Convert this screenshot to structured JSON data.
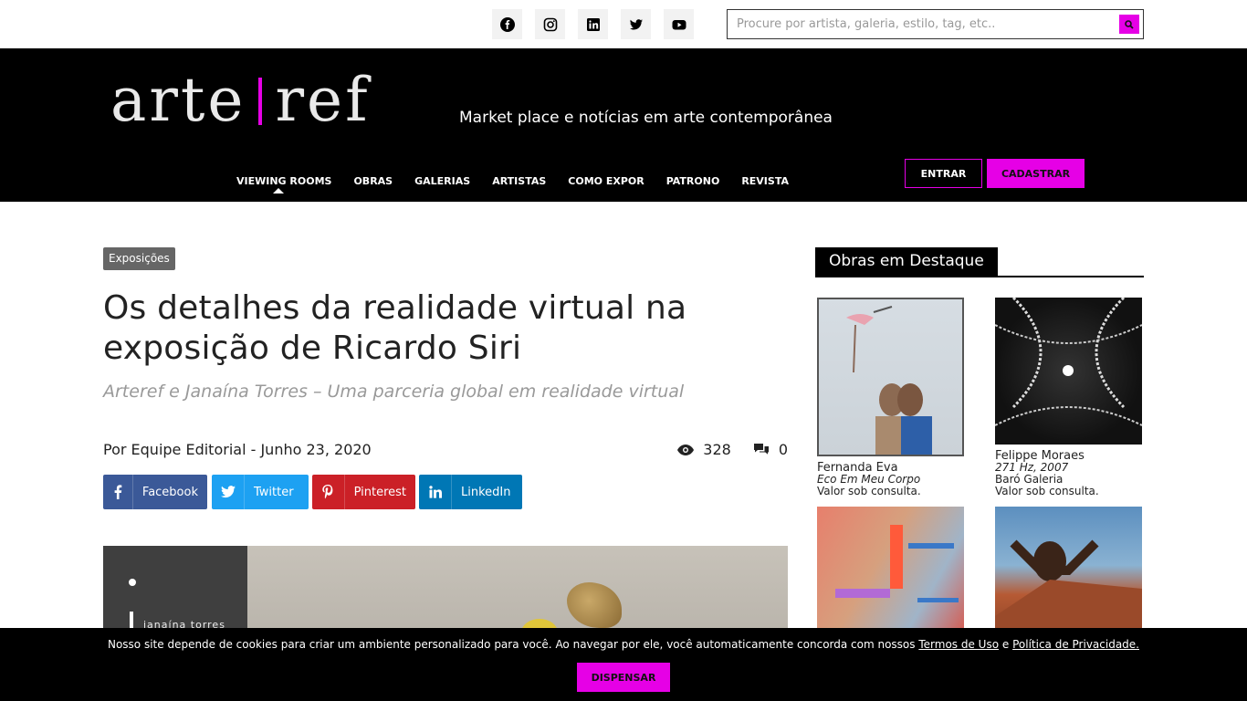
{
  "topbar": {
    "social_icons": [
      "facebook-icon",
      "instagram-icon",
      "linkedin-icon",
      "twitter-icon",
      "youtube-icon"
    ],
    "search_placeholder": "Procure por artista, galeria, estilo, tag, etc.."
  },
  "header": {
    "logo_left": "arte",
    "logo_right": "ref",
    "tagline": "Market place e notícias em arte contemporânea",
    "nav": [
      "VIEWING ROOMS",
      "OBRAS",
      "GALERIAS",
      "ARTISTAS",
      "COMO EXPOR",
      "PATRONO",
      "REVISTA"
    ],
    "entrar": "ENTRAR",
    "cadastrar": "CADASTRAR"
  },
  "article": {
    "category": "Exposições",
    "title": "Os detalhes da realidade virtual na exposição de Ricardo Siri",
    "subtitle": "Arteref e Janaína Torres – Uma parceria global em realidade virtual",
    "byline": "Por Equipe Editorial - Junho 23, 2020",
    "views": "328",
    "comments": "0",
    "share": {
      "facebook": "Facebook",
      "twitter": "Twitter",
      "pinterest": "Pinterest",
      "linkedin": "LinkedIn"
    },
    "hero_text": "janaína torres"
  },
  "sidebar": {
    "heading": "Obras em Destaque",
    "works": [
      {
        "artist": "Fernanda Eva",
        "title": "Eco Em Meu Corpo",
        "gallery": "",
        "price": "Valor sob consulta."
      },
      {
        "artist": "Felippe Moraes",
        "title": "271 Hz, 2007",
        "gallery": "Baró Galeria",
        "price": "Valor sob consulta."
      }
    ]
  },
  "cookie": {
    "text": "Nosso site depende de cookies para criar um ambiente personalizado para você. Ao navegar por ele, você automaticamente concorda com nossos",
    "terms": "Termos de Uso",
    "and": "e",
    "privacy": "Política de Privacidade.",
    "button": "DISPENSAR"
  },
  "colors": {
    "accent": "#e600e6",
    "facebook": "#3b5998",
    "twitter": "#1da1f2",
    "pinterest": "#cb2027",
    "linkedin": "#0077b5"
  }
}
